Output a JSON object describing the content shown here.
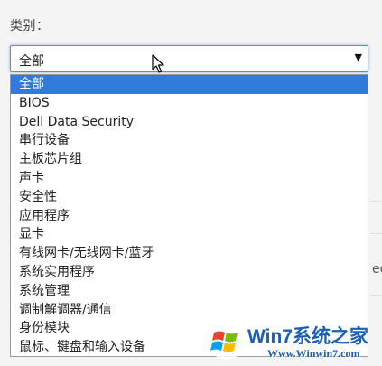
{
  "field": {
    "label": "类别："
  },
  "select": {
    "value": "全部",
    "caret": "▼"
  },
  "options": [
    {
      "label": "全部",
      "selected": true
    },
    {
      "label": "BIOS",
      "selected": false
    },
    {
      "label": "Dell Data Security",
      "selected": false
    },
    {
      "label": "串行设备",
      "selected": false
    },
    {
      "label": "主板芯片组",
      "selected": false
    },
    {
      "label": "声卡",
      "selected": false
    },
    {
      "label": "安全性",
      "selected": false
    },
    {
      "label": "应用程序",
      "selected": false
    },
    {
      "label": "显卡",
      "selected": false
    },
    {
      "label": "有线网卡/无线网卡/蓝牙",
      "selected": false
    },
    {
      "label": "系统实用程序",
      "selected": false
    },
    {
      "label": "系统管理",
      "selected": false
    },
    {
      "label": "调制解调器/通信",
      "selected": false
    },
    {
      "label": "身份模块",
      "selected": false
    },
    {
      "label": "鼠标、键盘和输入设备",
      "selected": false
    }
  ],
  "background": {
    "cut_text": "ec"
  },
  "watermark": {
    "title": "Win7系统之家",
    "url": "Www.Winwin7.com"
  },
  "colors": {
    "selected_bg": "#2f7bd9",
    "focus_border": "#5b8fc9",
    "watermark": "#1a5fb4"
  },
  "icons": {
    "cursor": "mouse-pointer-icon",
    "caret": "triangle-down-icon",
    "logo": "windows-logo-icon"
  }
}
